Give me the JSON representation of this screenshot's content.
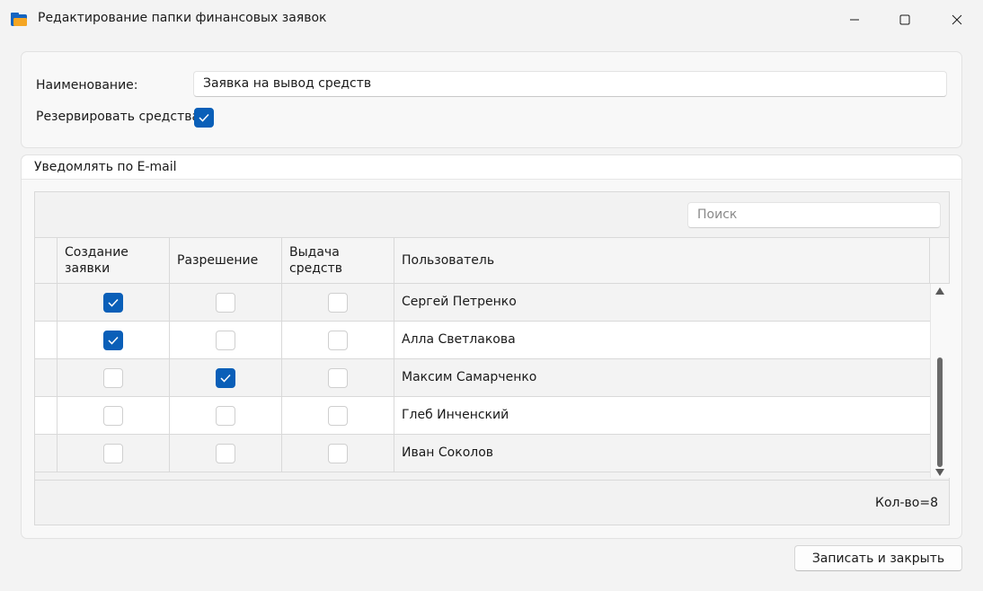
{
  "window": {
    "title": "Редактирование папки финансовых заявок",
    "icon": "folder-icon"
  },
  "form": {
    "name_label": "Наименование:",
    "name_value": "Заявка на вывод средств",
    "reserve_label": "Резервировать средства:",
    "reserve_checked": true
  },
  "email_group": {
    "title": "Уведомлять по E-mail",
    "search_placeholder": "Поиск",
    "columns": [
      "Создание заявки",
      "Разрешение",
      "Выдача средств",
      "Пользователь"
    ],
    "rows": [
      {
        "create": true,
        "approve": false,
        "issue": false,
        "user": "Сергей Петренко"
      },
      {
        "create": true,
        "approve": false,
        "issue": false,
        "user": "Алла Светлакова"
      },
      {
        "create": false,
        "approve": true,
        "issue": false,
        "user": "Максим Самарченко"
      },
      {
        "create": false,
        "approve": false,
        "issue": false,
        "user": "Глеб Инченский"
      },
      {
        "create": false,
        "approve": false,
        "issue": false,
        "user": "Иван Соколов"
      }
    ],
    "count_text": "Кол-во=8"
  },
  "buttons": {
    "save_close": "Записать и закрыть"
  },
  "colors": {
    "accent": "#0a5fb8"
  }
}
